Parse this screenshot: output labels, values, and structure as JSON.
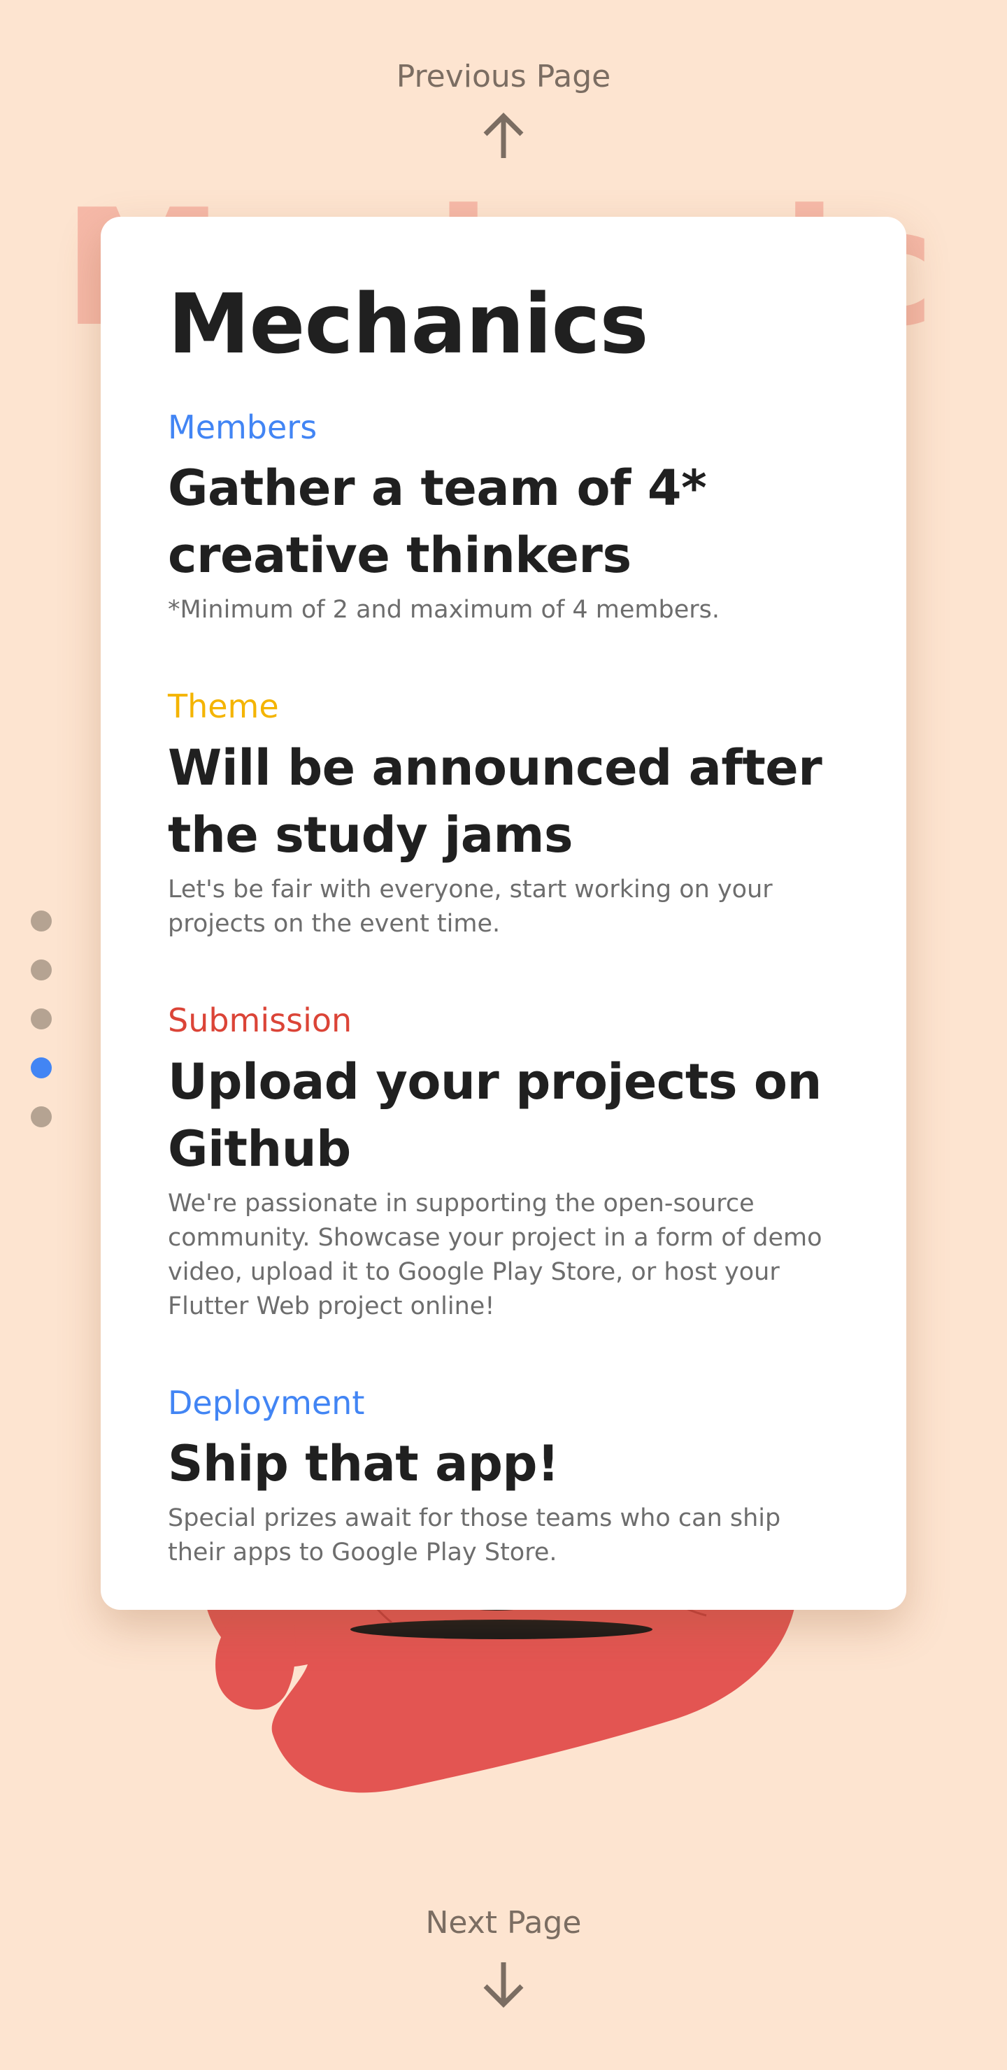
{
  "nav": {
    "previous_label": "Previous Page",
    "next_label": "Next Page"
  },
  "background_title": "Mechanics",
  "card": {
    "title": "Mechanics",
    "sections": [
      {
        "tag": "Members",
        "tag_color": "#4285f4",
        "headline": "Gather a team of 4* creative thinkers",
        "description": "*Minimum of 2 and maximum of 4 members."
      },
      {
        "tag": "Theme",
        "tag_color": "#f4b400",
        "headline": "Will be announced after the study jams",
        "description": "Let's be fair with everyone, start working on your projects on the event time."
      },
      {
        "tag": "Submission",
        "tag_color": "#db4437",
        "headline": "Upload your projects on Github",
        "description": "We're passionate in supporting the open-source community. Showcase your project in a form of demo video, upload it to Google Play Store, or host your Flutter Web project online!"
      },
      {
        "tag": "Deployment",
        "tag_color": "#4285f4",
        "headline": "Ship that app!",
        "description": "Special prizes await for those teams who can ship their apps to Google Play Store."
      }
    ]
  },
  "page_indicator": {
    "total": 5,
    "active_index": 3,
    "active_color": "#4285f4",
    "inactive_color": "#b5a392"
  },
  "icons": {
    "previous": "arrow-up-icon",
    "next": "arrow-down-icon"
  }
}
